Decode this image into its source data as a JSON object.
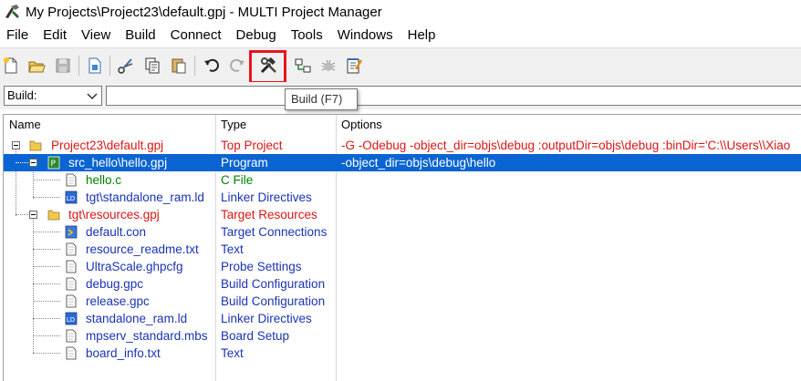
{
  "window": {
    "title": "My Projects\\Project23\\default.gpj - MULTI Project Manager"
  },
  "menu": [
    "File",
    "Edit",
    "View",
    "Build",
    "Connect",
    "Debug",
    "Tools",
    "Windows",
    "Help"
  ],
  "toolbar": {
    "tooltip": "Build (F7)"
  },
  "build": {
    "label": "Build:",
    "value": ""
  },
  "columns": {
    "name": "Name",
    "type": "Type",
    "options": "Options"
  },
  "rows": [
    {
      "name": "Project23\\default.gpj",
      "type": "Top Project",
      "options": "-G -Odebug -object_dir=objs\\debug :outputDir=objs\\debug :binDir='C:\\\\Users\\\\Xiao"
    },
    {
      "name": "src_hello\\hello.gpj",
      "type": "Program",
      "options": "-object_dir=objs\\debug\\hello"
    },
    {
      "name": "hello.c",
      "type": "C File",
      "options": ""
    },
    {
      "name": "tgt\\standalone_ram.ld",
      "type": "Linker Directives",
      "options": ""
    },
    {
      "name": "tgt\\resources.gpj",
      "type": "Target Resources",
      "options": ""
    },
    {
      "name": "default.con",
      "type": "Target Connections",
      "options": ""
    },
    {
      "name": "resource_readme.txt",
      "type": "Text",
      "options": ""
    },
    {
      "name": "UltraScale.ghpcfg",
      "type": "Probe Settings",
      "options": ""
    },
    {
      "name": "debug.gpc",
      "type": "Build Configuration",
      "options": ""
    },
    {
      "name": "release.gpc",
      "type": "Build Configuration",
      "options": ""
    },
    {
      "name": "standalone_ram.ld",
      "type": "Linker Directives",
      "options": ""
    },
    {
      "name": "mpserv_standard.mbs",
      "type": "Board Setup",
      "options": ""
    },
    {
      "name": "board_info.txt",
      "type": "Text",
      "options": ""
    }
  ],
  "colors": {
    "red": "#dc1414",
    "green": "#008000",
    "blue": "#1a33b4",
    "dark_red": "#8c0f2d",
    "selection": "#0a64d2"
  }
}
